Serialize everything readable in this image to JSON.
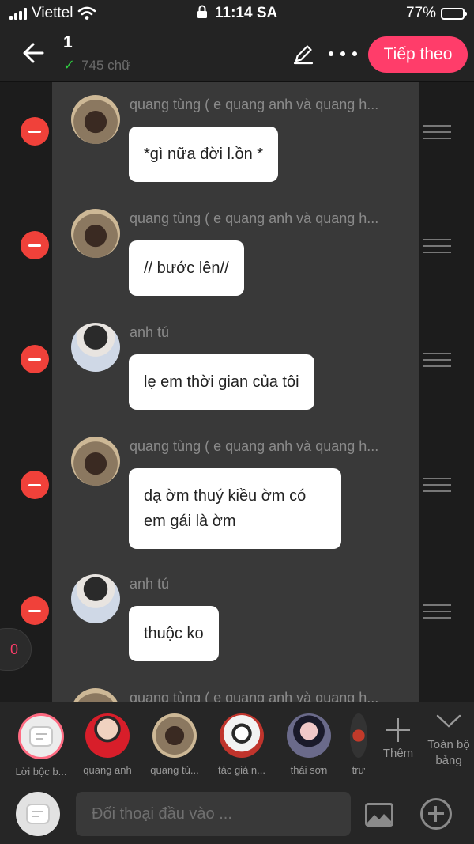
{
  "status": {
    "carrier": "Viettel",
    "time": "11:14 SA",
    "battery_pct": "77%",
    "battery_level": 0.77
  },
  "header": {
    "title": "1",
    "word_count": "745 chữ",
    "next_label": "Tiếp theo"
  },
  "messages": [
    {
      "name": "quang tùng ( e quang anh và quang h...",
      "text": "*gì nữa đời l.ồn *",
      "avatar": "quang-tung"
    },
    {
      "name": "quang tùng ( e quang anh và quang h...",
      "text": "// bước lên//",
      "avatar": "quang-tung"
    },
    {
      "name": "anh tú",
      "text": "lẹ em thời gian của tôi",
      "avatar": "anh-tu"
    },
    {
      "name": "quang tùng ( e quang anh và quang h...",
      "text": "dạ ờm thuý kiều ờm có em gái là ờm",
      "avatar": "quang-tung"
    },
    {
      "name": "anh tú",
      "text": "thuộc ko",
      "avatar": "anh-tu"
    },
    {
      "name": "quang tùng ( e quang anh và quang h...",
      "avatar": "quang-tung"
    }
  ],
  "side_count": "0",
  "characters": [
    {
      "label": "Lời bộc b..."
    },
    {
      "label": "quang anh"
    },
    {
      "label": "quang tù..."
    },
    {
      "label": "tác giả n..."
    },
    {
      "label": "thái sơn"
    },
    {
      "label": "trư"
    }
  ],
  "add_label": "Thêm",
  "all_label": "Toàn bộ bảng",
  "input": {
    "placeholder": "Đối thoại đầu vào ..."
  },
  "colors": {
    "accent": "#ff3d6a",
    "delete": "#f0413a",
    "check": "#2ecc40"
  }
}
